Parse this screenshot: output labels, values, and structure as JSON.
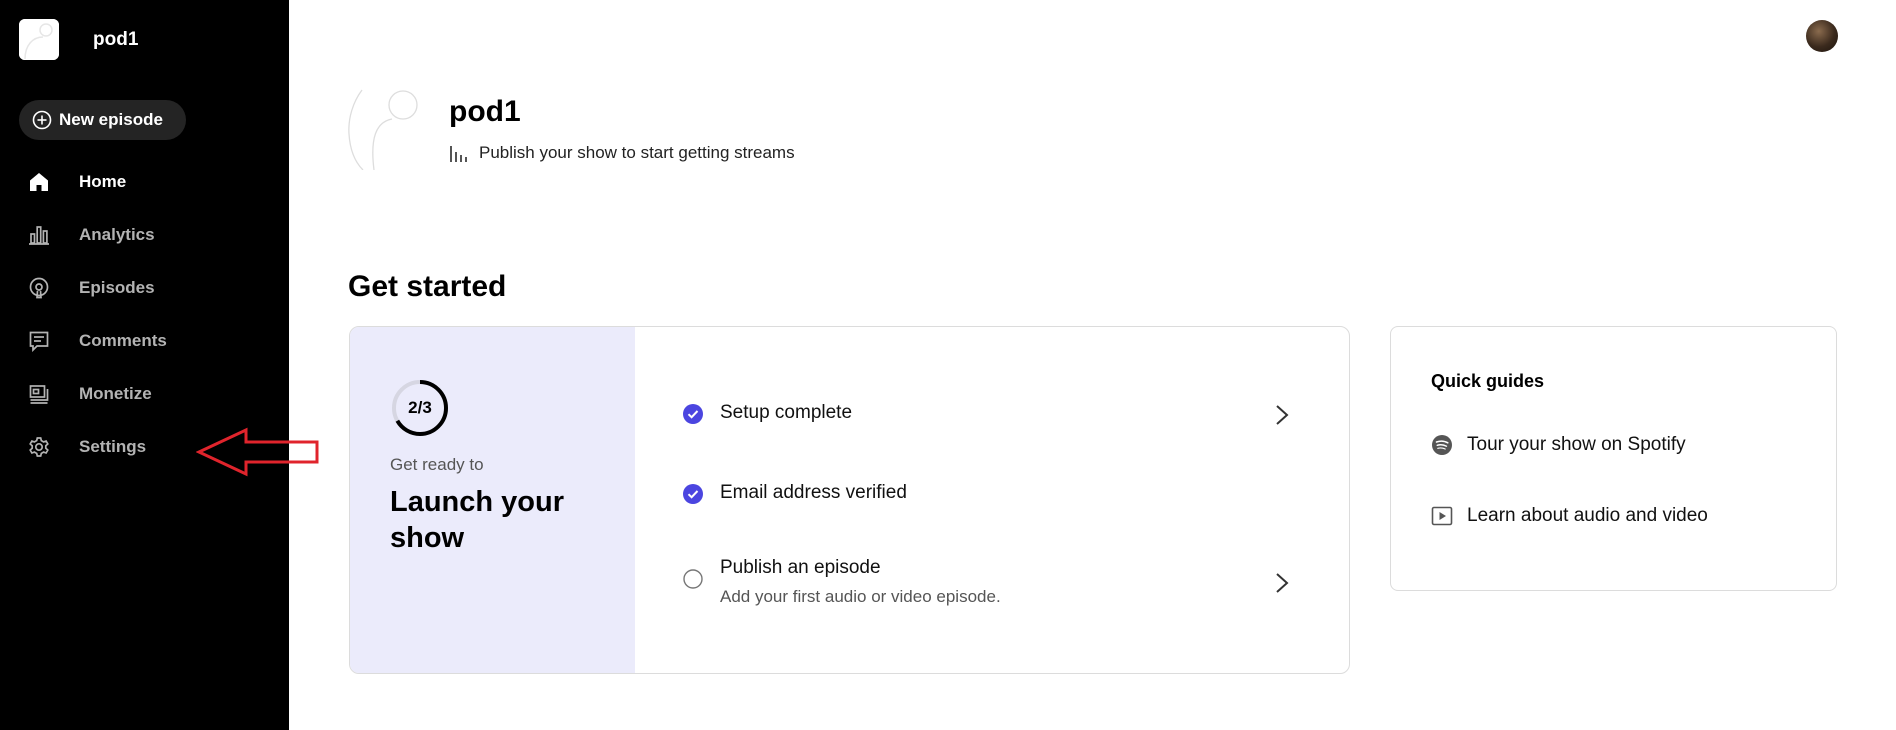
{
  "sidebar": {
    "show_name": "pod1",
    "new_episode_label": "New episode",
    "items": [
      {
        "label": "Home",
        "icon": "home-icon",
        "active": true
      },
      {
        "label": "Analytics",
        "icon": "bar-chart-icon",
        "active": false
      },
      {
        "label": "Episodes",
        "icon": "podcast-icon",
        "active": false
      },
      {
        "label": "Comments",
        "icon": "comment-icon",
        "active": false
      },
      {
        "label": "Monetize",
        "icon": "monetize-icon",
        "active": false
      },
      {
        "label": "Settings",
        "icon": "gear-icon",
        "active": false
      }
    ]
  },
  "header": {
    "show_title": "pod1",
    "subtitle": "Publish your show to start getting streams"
  },
  "main": {
    "section_title": "Get started",
    "launch": {
      "progress_label": "2/3",
      "progress_fraction": 0.667,
      "eyebrow": "Get ready to",
      "title": "Launch your show",
      "tasks": [
        {
          "label": "Setup complete",
          "done": true,
          "desc": ""
        },
        {
          "label": "Email address verified",
          "done": true,
          "desc": ""
        },
        {
          "label": "Publish an episode",
          "done": false,
          "desc": "Add your first audio or video episode."
        }
      ]
    },
    "guides": {
      "title": "Quick guides",
      "items": [
        {
          "label": "Tour your show on Spotify",
          "icon": "spotify-icon"
        },
        {
          "label": "Learn about audio and video",
          "icon": "play-icon"
        }
      ]
    }
  },
  "colors": {
    "sidebar_bg": "#000000",
    "accent": "#4b45e0",
    "launch_panel_bg": "#ebebfb",
    "annotation_arrow": "#e0242c"
  }
}
